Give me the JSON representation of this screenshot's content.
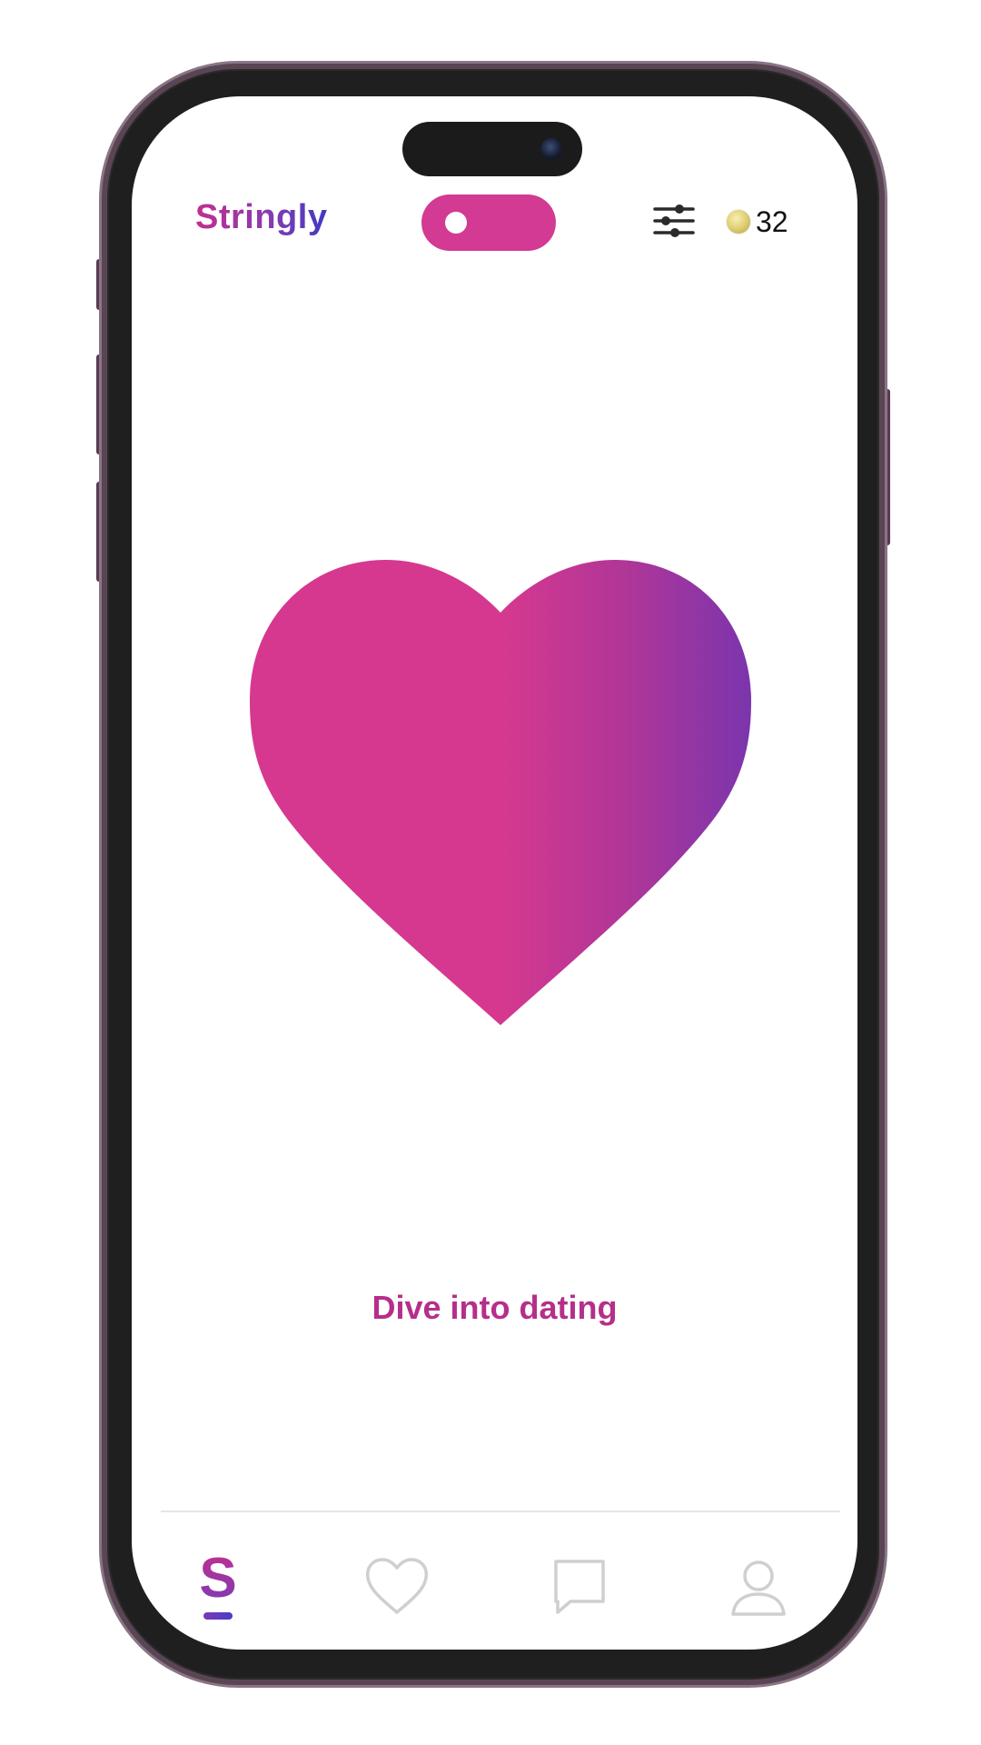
{
  "app": {
    "brand": "Stringly"
  },
  "header": {
    "toggle_state": "off",
    "filter_icon": "sliders-icon",
    "coin_icon": "coin-icon",
    "coin_count": "32"
  },
  "main": {
    "hero_icon": "heart-icon",
    "cta_text": "Dive into dating"
  },
  "nav": {
    "items": [
      {
        "name": "discover",
        "icon": "stringly-s-icon",
        "active": true
      },
      {
        "name": "likes",
        "icon": "heart-outline-icon",
        "active": false
      },
      {
        "name": "chats",
        "icon": "chat-bubble-icon",
        "active": false
      },
      {
        "name": "profile",
        "icon": "person-icon",
        "active": false
      }
    ]
  },
  "colors": {
    "accent_pink": "#d23a93",
    "accent_purple": "#7b3bb6",
    "accent_blue": "#3e3bc4",
    "cta_text": "#b52f8a",
    "nav_inactive": "#cfcfcf"
  }
}
